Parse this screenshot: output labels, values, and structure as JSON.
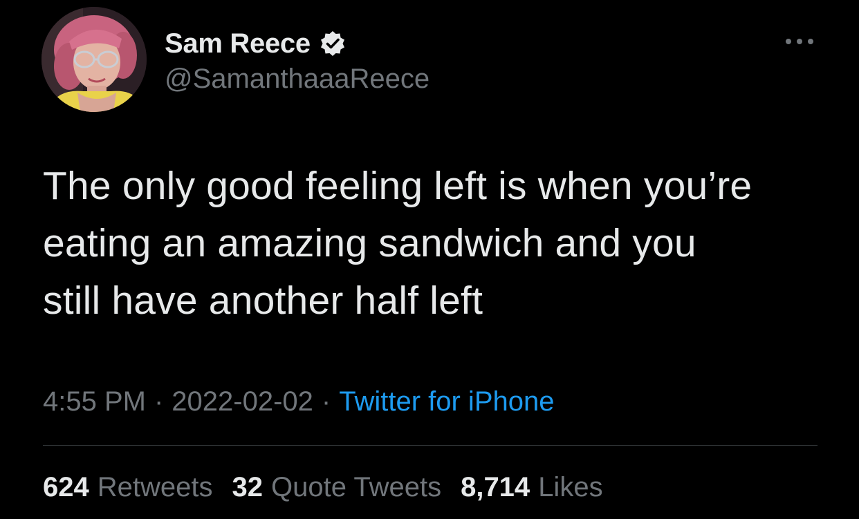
{
  "author": {
    "display_name": "Sam Reece",
    "handle": "@SamanthaaaReece",
    "verified_icon": "verified-badge-icon",
    "avatar": "profile-photo"
  },
  "menu": {
    "more_icon": "more-options-icon"
  },
  "tweet": {
    "text": "The only good feeling left is when you’re\neating an amazing sandwich and you\nstill have another half left"
  },
  "meta": {
    "time": "4:55 PM",
    "separator": "·",
    "date": "2022-02-02",
    "source": "Twitter for iPhone"
  },
  "stats": {
    "retweets_count": "624",
    "retweets_label": "Retweets",
    "quotes_count": "32",
    "quotes_label": "Quote Tweets",
    "likes_count": "8,714",
    "likes_label": "Likes"
  },
  "colors": {
    "background": "#000000",
    "text_primary": "#e7e9ea",
    "text_secondary": "#71767b",
    "link": "#1d9bf0",
    "divider": "#2f3336"
  }
}
